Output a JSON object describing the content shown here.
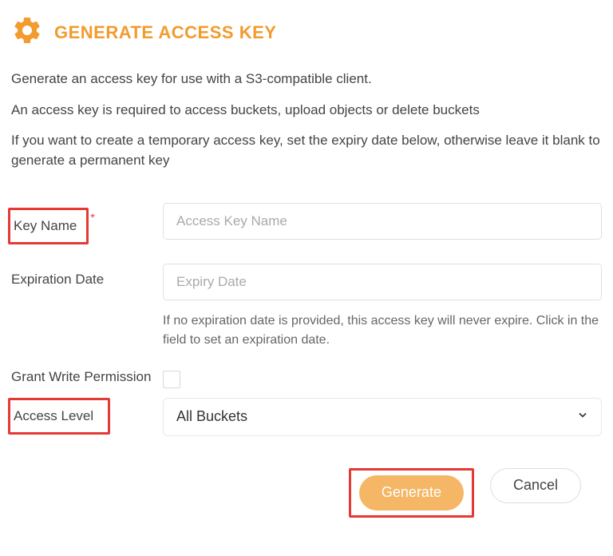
{
  "header": {
    "title": "GENERATE ACCESS KEY"
  },
  "descriptions": {
    "line1": "Generate an access key for use with a S3-compatible client.",
    "line2": "An access key is required to access buckets, upload objects or delete buckets",
    "line3": "If you want to create a temporary access key, set the expiry date below, otherwise leave it blank to generate a permanent key"
  },
  "form": {
    "keyName": {
      "label": "Key Name",
      "placeholder": "Access Key Name"
    },
    "expirationDate": {
      "label": "Expiration Date",
      "placeholder": "Expiry Date",
      "help": "If no expiration date is provided, this access key will never expire. Click in the field to set an expiration date."
    },
    "grantWrite": {
      "label": "Grant Write Permission"
    },
    "accessLevel": {
      "label": "Access Level",
      "selected": "All Buckets"
    }
  },
  "buttons": {
    "generate": "Generate",
    "cancel": "Cancel"
  }
}
